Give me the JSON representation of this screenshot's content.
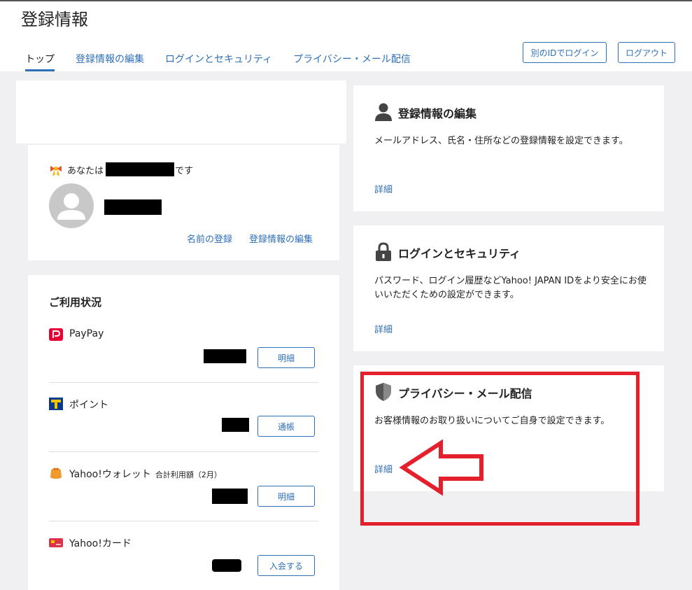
{
  "header": {
    "title": "登録情報",
    "tabs": [
      {
        "label": "トップ",
        "active": true
      },
      {
        "label": "登録情報の編集",
        "active": false
      },
      {
        "label": "ログインとセキュリティ",
        "active": false
      },
      {
        "label": "プライバシー・メール配信",
        "active": false
      }
    ],
    "login_other_label": "別のIDでログイン",
    "logout_label": "ログアウト"
  },
  "profile": {
    "prefix": "あなたは",
    "suffix": "です",
    "links": {
      "register_name": "名前の登録",
      "edit_info": "登録情報の編集"
    }
  },
  "usage": {
    "title": "ご利用状況",
    "services": [
      {
        "name": "PayPay",
        "sub": "",
        "button": "明細",
        "icon": "paypay-icon"
      },
      {
        "name": "ポイント",
        "sub": "",
        "button": "通帳",
        "icon": "t-point-icon"
      },
      {
        "name": "Yahoo!ウォレット",
        "sub": "合計利用額（2月）",
        "button": "明細",
        "icon": "wallet-icon"
      },
      {
        "name": "Yahoo!カード",
        "sub": "",
        "button": "入会する",
        "icon": "card-icon"
      }
    ]
  },
  "right_cards": [
    {
      "title": "登録情報の編集",
      "desc": "メールアドレス、氏名・住所などの登録情報を設定できます。",
      "link": "詳細",
      "icon": "user-icon"
    },
    {
      "title": "ログインとセキュリティ",
      "desc": "パスワード、ログイン履歴などYahoo! JAPAN IDをより安全にお使いいただくための設定ができます。",
      "link": "詳細",
      "icon": "lock-icon"
    },
    {
      "title": "プライバシー・メール配信",
      "desc": "お客様情報のお取り扱いについてご自身で設定できます。",
      "link": "詳細",
      "icon": "shield-icon"
    }
  ],
  "colors": {
    "accent": "#2f6fb7",
    "highlight": "#e3202b",
    "background": "#f0f0f2"
  }
}
